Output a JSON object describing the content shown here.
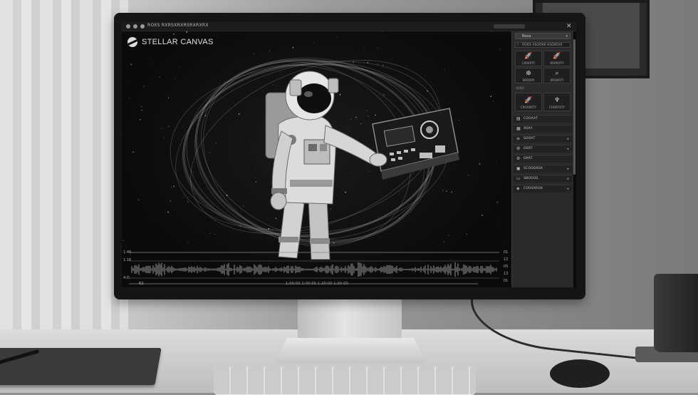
{
  "window": {
    "title": "ROXS  RXRSXRXRSRXRXRX",
    "close_glyph": "✕"
  },
  "app": {
    "logo_text": "STELLAR CANVAS"
  },
  "panel": {
    "select_value": "Rooa",
    "search_placeholder": "ROOS XSOORK XSOXRXX",
    "tools_top": [
      {
        "icon": "rocket-icon",
        "glyph": "🚀",
        "label": "CXOXXTY"
      },
      {
        "icon": "rocket-icon",
        "glyph": "🚀",
        "label": "XOOROTY"
      },
      {
        "icon": "compass-icon",
        "glyph": "⊕",
        "label": "SROORY"
      },
      {
        "icon": "search-icon",
        "glyph": "⌕",
        "label": "XROXOTY"
      }
    ],
    "section_label": "KIXO",
    "tools_bottom": [
      {
        "icon": "rocket-icon",
        "glyph": "🚀",
        "label": "CROOXOTY"
      },
      {
        "icon": "pin-icon",
        "glyph": "♆",
        "label": "COOXTOTY"
      }
    ],
    "list": [
      {
        "icon": "layers-icon",
        "glyph": "▤",
        "label": "COOAXT",
        "chevron": ""
      },
      {
        "icon": "grid-icon",
        "glyph": "▦",
        "label": "XOXY",
        "chevron": ""
      },
      {
        "icon": "sliders-icon",
        "glyph": "≡",
        "label": "SOOXT",
        "chevron": "▸"
      },
      {
        "icon": "settings-icon",
        "glyph": "⚙",
        "label": "OXRT",
        "chevron": "▸"
      },
      {
        "icon": "gear-icon",
        "glyph": "⚙",
        "label": "OXRT",
        "chevron": ""
      },
      {
        "icon": "image-icon",
        "glyph": "▣",
        "label": "SCOOOXOX",
        "chevron": "▸"
      },
      {
        "icon": "folder-icon",
        "glyph": "▭",
        "label": "SBOOOS",
        "chevron": "▸"
      },
      {
        "icon": "stack-icon",
        "glyph": "◈",
        "label": "COOSXROX",
        "chevron": "▸"
      }
    ]
  },
  "timeline": {
    "left_top": "1:40",
    "left_mid": "1:16",
    "left_bottom": "4:D",
    "bottom_left": "B2",
    "time_readout": "1:00:00  1:00:00  1:20:00  1:00:00",
    "right_labels": [
      "01",
      "12",
      "05",
      "13",
      "01"
    ]
  },
  "colors": {
    "screen_bg": "#0a0a0a",
    "panel_bg": "#2a2a2a",
    "accent": "#d6d6d6"
  }
}
